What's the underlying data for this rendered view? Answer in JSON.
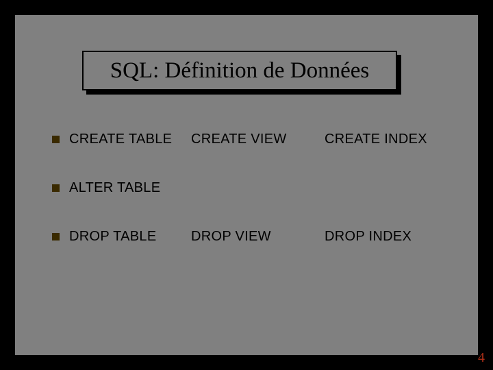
{
  "title": "SQL: Définition de Données",
  "rows": [
    {
      "col1": "CREATE TABLE",
      "col2": "CREATE VIEW",
      "col3": "CREATE INDEX"
    },
    {
      "col1": "ALTER TABLE",
      "col2": "",
      "col3": ""
    },
    {
      "col1": "DROP TABLE",
      "col2": "DROP VIEW",
      "col3": "DROP INDEX"
    }
  ],
  "page_number": "4"
}
